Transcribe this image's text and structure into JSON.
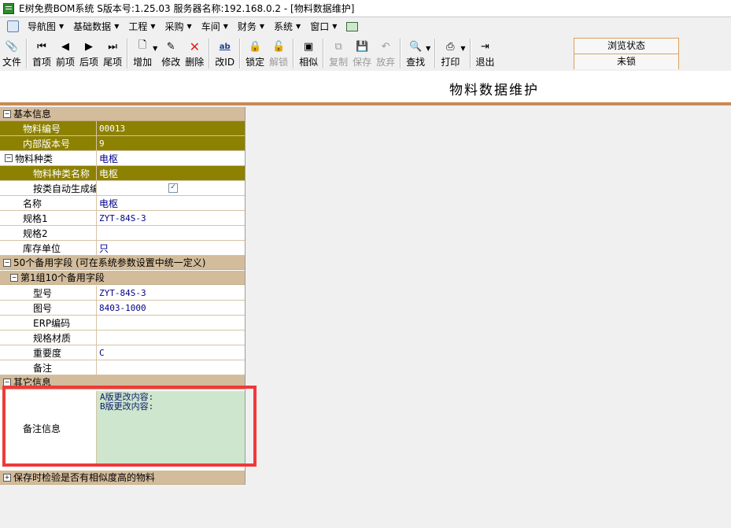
{
  "window": {
    "title": "E树免费BOM系统 S版本号:1.25.03   服务器名称:192.168.0.2 - [物料数据维护]"
  },
  "menu": [
    "导航图",
    "基础数据",
    "工程",
    "采购",
    "车间",
    "财务",
    "系统",
    "窗口"
  ],
  "toolbar": {
    "file": "文件",
    "first": "首项",
    "prev": "前项",
    "next": "后项",
    "last": "尾项",
    "add": "增加",
    "edit": "修改",
    "delete": "删除",
    "change_id": "改ID",
    "lock": "锁定",
    "unlock": "解锁",
    "similar": "相似",
    "copy": "复制",
    "save": "保存",
    "discard": "放弃",
    "find": "查找",
    "print": "打印",
    "exit": "退出",
    "change_id_icon_text": "ab"
  },
  "state": {
    "browse": "浏览状态",
    "unlocked": "未锁"
  },
  "page": {
    "heading": "物料数据维护"
  },
  "grid": {
    "basic": "基本信息",
    "material_no": {
      "label": "物料编号",
      "value": "00013"
    },
    "revision": {
      "label": "内部版本号",
      "value": "9"
    },
    "category": {
      "label": "物料种类",
      "value": "电枢"
    },
    "category_name": {
      "label": "物料种类名称",
      "value": "电枢"
    },
    "auto_generate": {
      "label": "按类自动生成编",
      "checked": true
    },
    "name": {
      "label": "名称",
      "value": "电枢"
    },
    "spec1": {
      "label": "规格1",
      "value": "ZYT-84S-3"
    },
    "spec2": {
      "label": "规格2",
      "value": ""
    },
    "unit": {
      "label": "库存单位",
      "value": "只"
    },
    "reserve": "50个备用字段 (可在系统参数设置中统一定义)",
    "group1": "第1组10个备用字段",
    "model": {
      "label": "型号",
      "value": "ZYT-84S-3"
    },
    "drawing": {
      "label": "图号",
      "value": "8403-1000"
    },
    "erp": {
      "label": "ERP编码",
      "value": ""
    },
    "material_spec": {
      "label": "规格材质",
      "value": ""
    },
    "importance": {
      "label": "重要度",
      "value": "C"
    },
    "remark": {
      "label": "备注",
      "value": ""
    },
    "other": "其它信息",
    "note": {
      "label": "备注信息",
      "line1": "A版更改内容:",
      "line2": "B版更改内容:"
    },
    "check_similar": "保存时检验是否有相似度高的物料"
  }
}
